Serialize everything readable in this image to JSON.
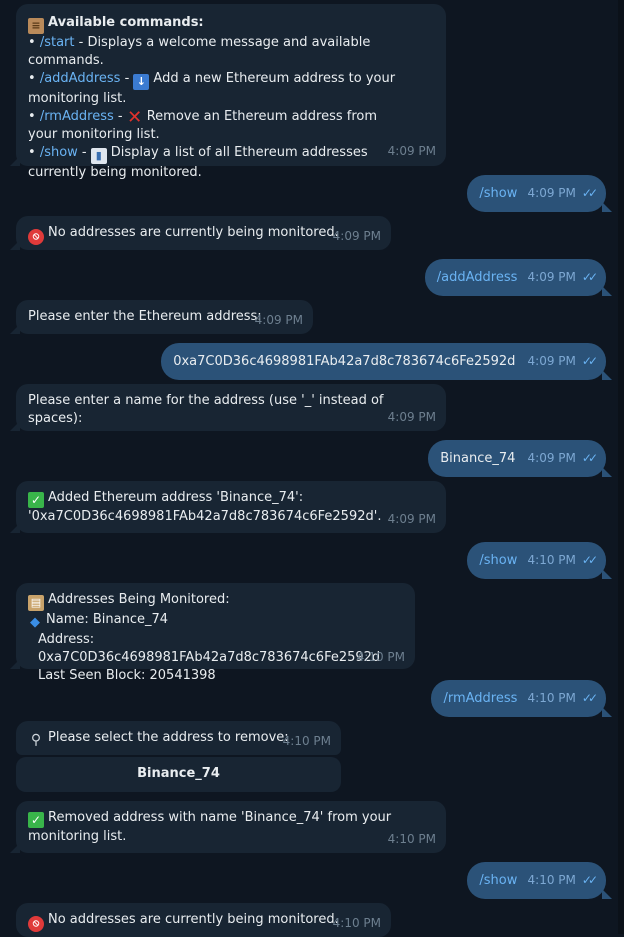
{
  "colors": {
    "background": "#0e1621",
    "incoming_bubble": "#182533",
    "outgoing_bubble": "#2b5278",
    "link": "#6ab3f3",
    "time": "#6d7f8f"
  },
  "m1": {
    "title": "Available commands:",
    "l1_cmd": "/start",
    "l1_text": " - Displays a welcome message and available commands.",
    "l2_cmd": "/addAddress",
    "l2_text": "Add a new Ethereum address to your monitoring list.",
    "l3_cmd": "/rmAddress",
    "l3_text": "Remove an Ethereum address from your monitoring list.",
    "l4_cmd": "/show",
    "l4_text": "Display a list of all Ethereum addresses currently being monitored.",
    "time": "4:09 PM"
  },
  "o1": {
    "text": "/show",
    "time": "4:09 PM"
  },
  "m2": {
    "text": "No addresses are currently being monitored.",
    "time": "4:09 PM"
  },
  "o2": {
    "text": "/addAddress",
    "time": "4:09 PM"
  },
  "m3": {
    "text": "Please enter the Ethereum address:",
    "time": "4:09 PM"
  },
  "o3": {
    "text": "0xa7C0D36c4698981FAb42a7d8c783674c6Fe2592d",
    "time": "4:09 PM"
  },
  "m4": {
    "text": "Please enter a name for the address (use '_' instead of spaces):",
    "time": "4:09 PM"
  },
  "o4": {
    "text": "Binance_74",
    "time": "4:09 PM"
  },
  "m5": {
    "line1": "Added Ethereum address 'Binance_74':",
    "line2": "'0xa7C0D36c4698981FAb42a7d8c783674c6Fe2592d'.",
    "time": "4:09 PM"
  },
  "o5": {
    "text": "/show",
    "time": "4:10 PM"
  },
  "m6": {
    "title": "Addresses Being Monitored:",
    "name": "Name: Binance_74",
    "address": "Address: 0xa7C0D36c4698981FAb42a7d8c783674c6Fe2592d",
    "block": "Last Seen Block: 20541398",
    "time": "4:10 PM"
  },
  "o6": {
    "text": "/rmAddress",
    "time": "4:10 PM"
  },
  "m7": {
    "text": "Please select the address to remove:",
    "time": "4:10 PM",
    "button": "Binance_74"
  },
  "m8": {
    "line1": "Removed address with name 'Binance_74' from your",
    "line2": "monitoring list.",
    "time": "4:10 PM"
  },
  "o7": {
    "text": "/show",
    "time": "4:10 PM"
  },
  "m9": {
    "text": "No addresses are currently being monitored.",
    "time": "4:10 PM"
  }
}
